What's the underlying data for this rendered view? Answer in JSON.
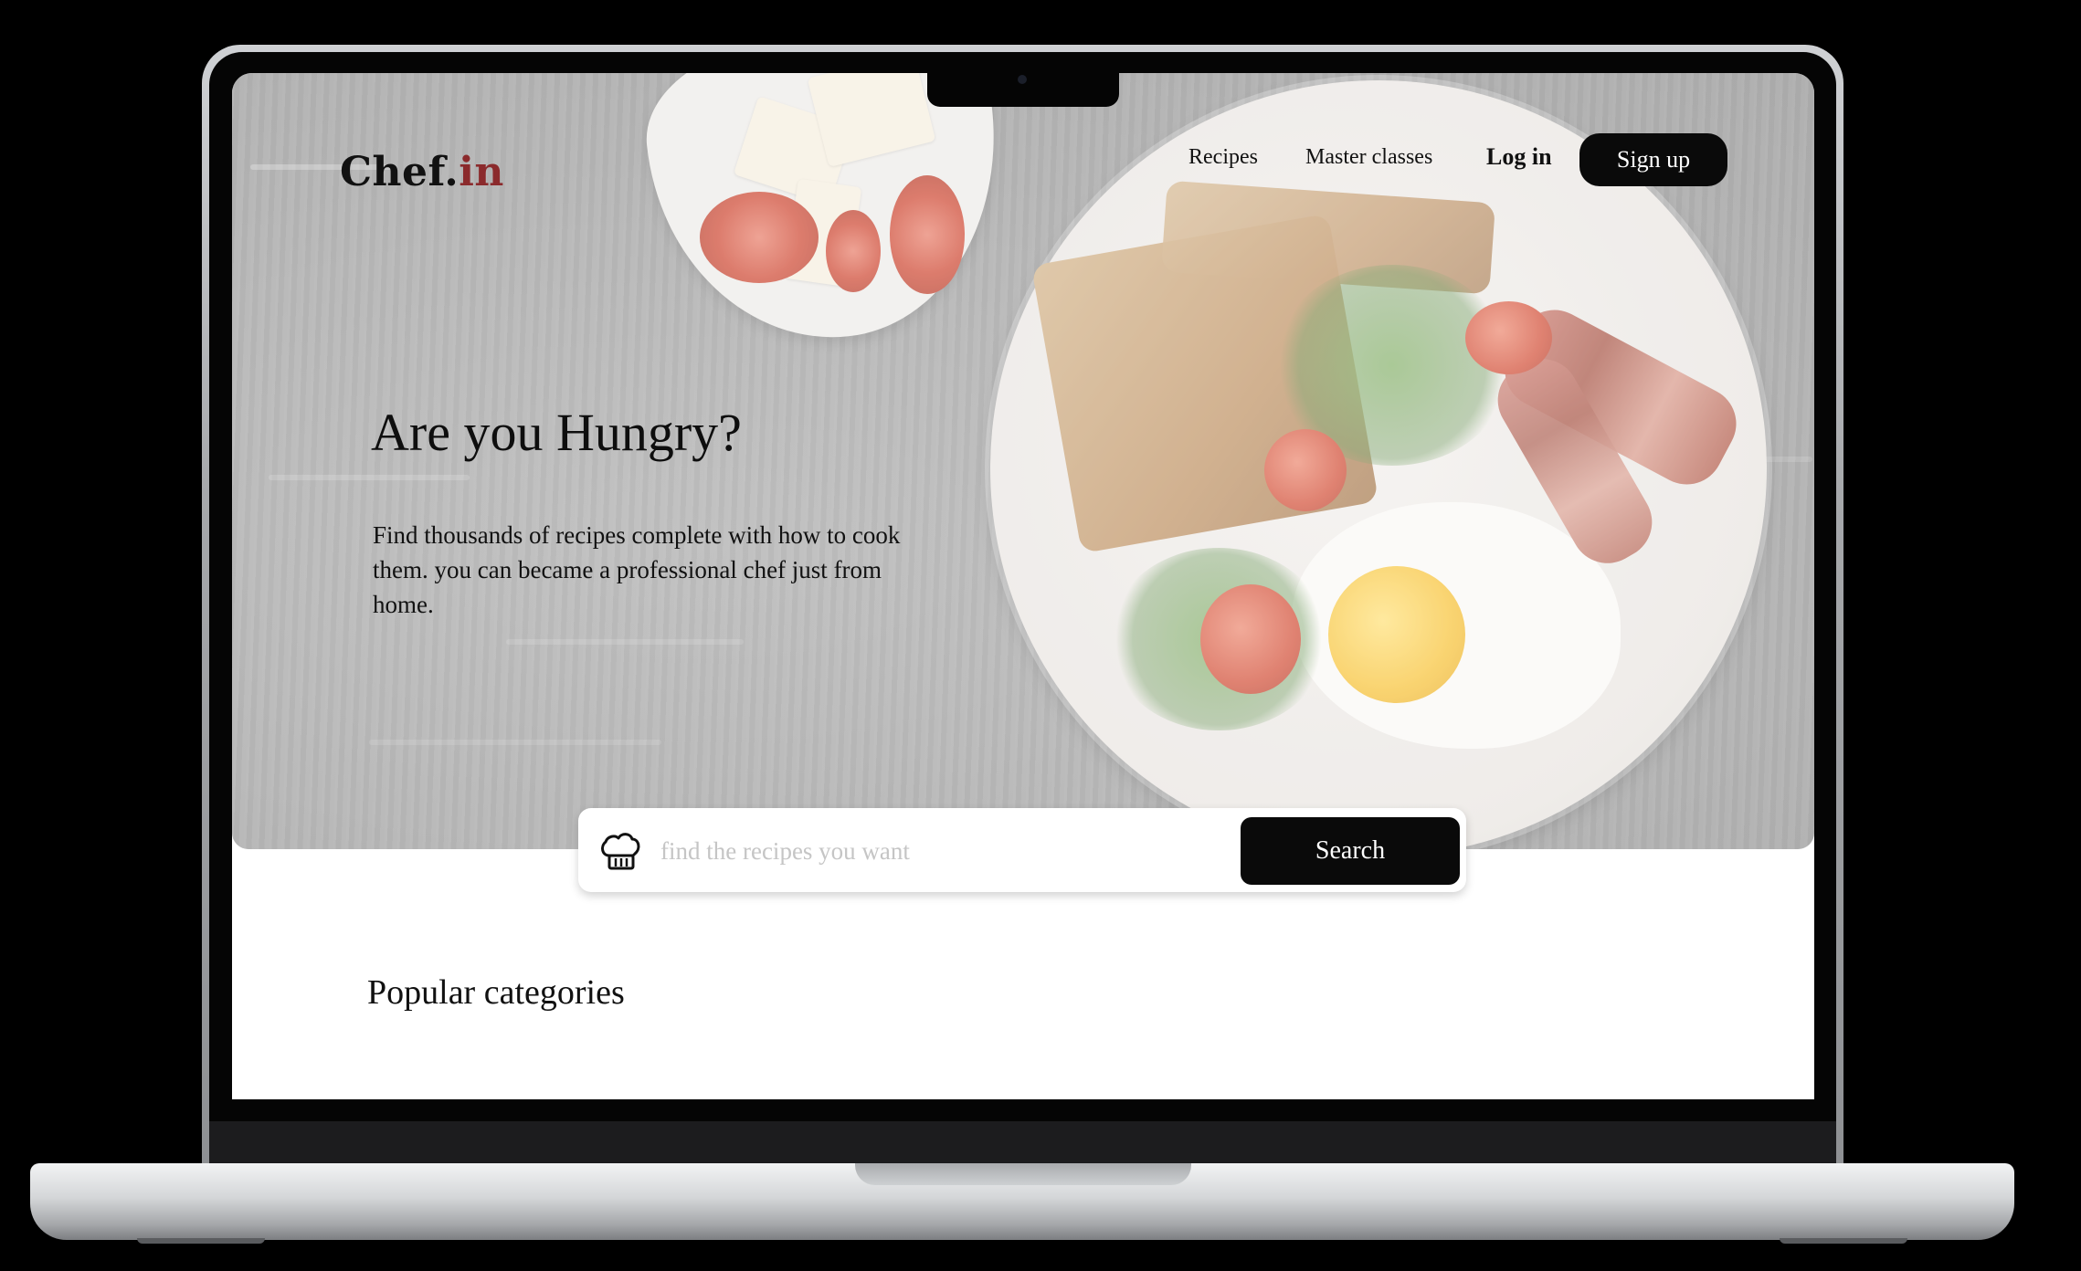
{
  "brand": {
    "logo_main": "Chef.",
    "logo_accent": "in",
    "accent_color": "#8b2a2c"
  },
  "nav": {
    "links": [
      {
        "label": "Recipes"
      },
      {
        "label": "Master classes"
      }
    ],
    "login_label": "Log in",
    "signup_label": "Sign up"
  },
  "hero": {
    "title": "Are you Hungry?",
    "description": "Find thousands of recipes complete with how to cook them. you can became a professional chef just from home."
  },
  "search": {
    "placeholder": "find the recipes you want",
    "button_label": "Search",
    "icon": "chef-hat-icon"
  },
  "sections": {
    "popular_title": "Popular categories"
  }
}
